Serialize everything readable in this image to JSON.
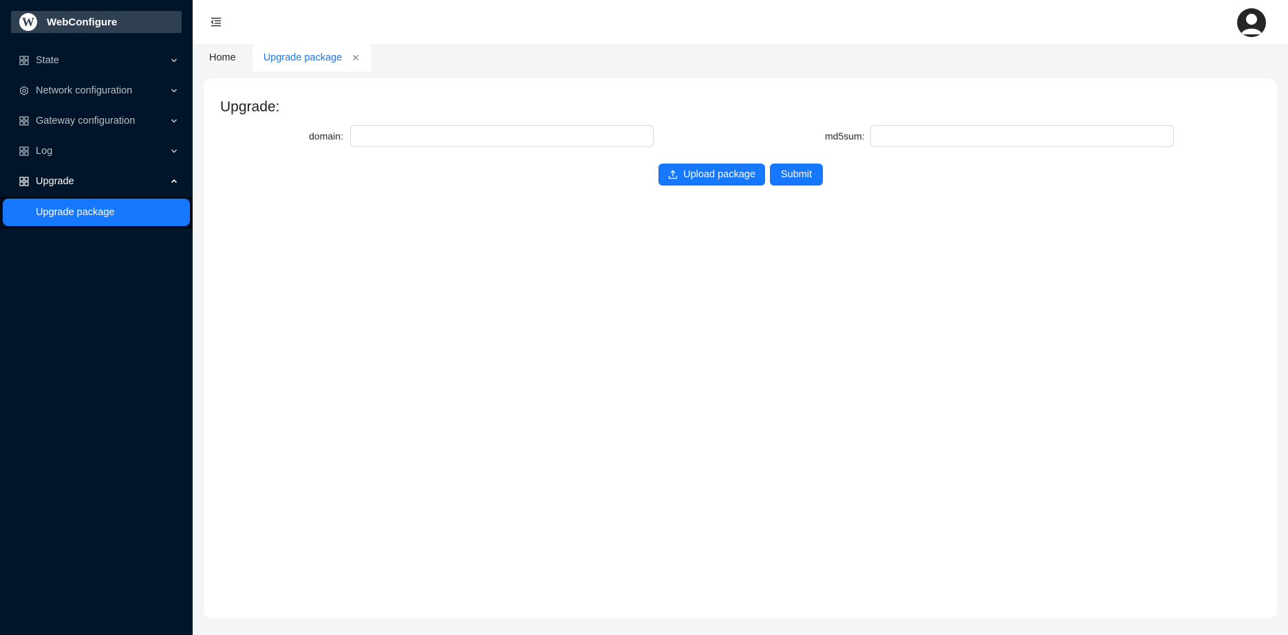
{
  "app": {
    "title": "WebConfigure",
    "logo_glyph": "W"
  },
  "sidebar": {
    "items": [
      {
        "label": "State",
        "icon": "appstore-icon",
        "expanded": false
      },
      {
        "label": "Network configuration",
        "icon": "setting-icon",
        "expanded": false
      },
      {
        "label": "Gateway configuration",
        "icon": "appstore-icon",
        "expanded": false
      },
      {
        "label": "Log",
        "icon": "appstore-icon",
        "expanded": false
      },
      {
        "label": "Upgrade",
        "icon": "appstore-icon",
        "expanded": true,
        "children": [
          {
            "label": "Upgrade package",
            "selected": true
          }
        ]
      }
    ]
  },
  "tabs": [
    {
      "label": "Home",
      "active": false
    },
    {
      "label": "Upgrade package",
      "active": true,
      "close_glyph": "✕"
    }
  ],
  "form": {
    "title": "Upgrade:",
    "domain_label": "domain:",
    "domain_value": "",
    "md5_label": "md5sum:",
    "md5_value": "",
    "upload_label": "Upload package",
    "submit_label": "Submit"
  },
  "colors": {
    "sidebar_bg": "#001529",
    "accent": "#1677ff",
    "content_bg": "#f5f5f5"
  }
}
